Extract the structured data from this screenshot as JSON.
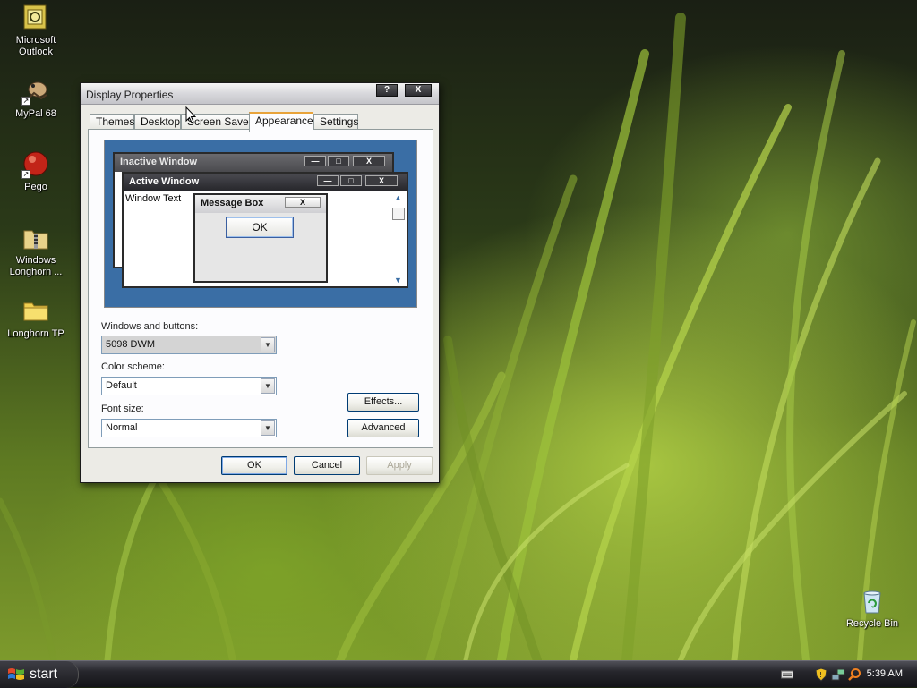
{
  "desktop": {
    "icons": [
      {
        "label": "Microsoft Outlook"
      },
      {
        "label": "MyPal 68"
      },
      {
        "label": "Pego"
      },
      {
        "label": "Windows Longhorn ..."
      },
      {
        "label": "Longhorn TP"
      },
      {
        "label": "Recycle Bin"
      }
    ]
  },
  "dialog": {
    "title": "Display Properties",
    "help_btn": "?",
    "close_btn": "X",
    "tabs": [
      {
        "label": "Themes"
      },
      {
        "label": "Desktop"
      },
      {
        "label": "Screen Saver"
      },
      {
        "label": "Appearance"
      },
      {
        "label": "Settings"
      }
    ],
    "active_tab": "Appearance",
    "preview": {
      "inactive_title": "Inactive Window",
      "active_title": "Active Window",
      "window_text": "Window Text",
      "message_title": "Message Box",
      "ok_label": "OK",
      "min_glyph": "—",
      "max_glyph": "□",
      "close_glyph": "X"
    },
    "windows_buttons": {
      "label": "Windows and buttons:",
      "value": "5098 DWM"
    },
    "color_scheme": {
      "label": "Color scheme:",
      "value": "Default"
    },
    "font_size": {
      "label": "Font size:",
      "value": "Normal"
    },
    "effects_btn": "Effects...",
    "advanced_btn": "Advanced",
    "ok_btn": "OK",
    "cancel_btn": "Cancel",
    "apply_btn": "Apply"
  },
  "taskbar": {
    "start_label": "start",
    "clock": "5:39 AM"
  },
  "colors": {
    "preview_bg": "#3a6ea5",
    "active_title": "#2b2b2f",
    "inactive_title": "#5a5a5e",
    "tab_highlight": "#e8a33a"
  }
}
